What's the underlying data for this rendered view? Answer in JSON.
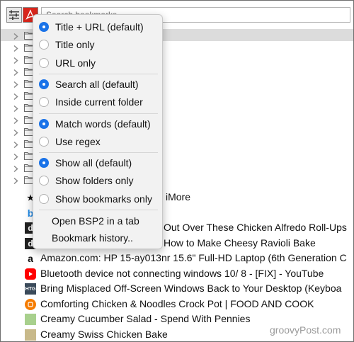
{
  "toolbar": {
    "options_icon": "sliders-icon",
    "pdf_icon": "acrobat-icon",
    "search_value": "",
    "search_placeholder": "Search bookmarks"
  },
  "tree": {
    "folder_rows": 13,
    "folder_icon": "folder-icon",
    "chevron_icon": "chevron-right-icon"
  },
  "bookmarks": [
    {
      "text": "iMore",
      "favicon": "imore-favicon",
      "color": "#111111"
    },
    {
      "text": "",
      "favicon": "bing-favicon",
      "color": "#1e88e5"
    },
    {
      "text": "Out Over These Chicken Alfredo Roll-Ups",
      "favicon": "dotdash-favicon",
      "color": "#222222"
    },
    {
      "text": "How to Make Cheesy Ravioli Bake",
      "favicon": "dotdash-favicon",
      "color": "#222222"
    },
    {
      "text": "Amazon.com: HP 15-ay013nr 15.6\" Full-HD Laptop (6th Generation C",
      "favicon": "amazon-favicon",
      "color": "#111111"
    },
    {
      "text": "Bluetooth device not connecting windows 10/ 8 - [FIX] - YouTube",
      "favicon": "youtube-favicon",
      "color": "#ff0000"
    },
    {
      "text": "Bring Misplaced Off-Screen Windows Back to Your Desktop (Keyboa",
      "favicon": "htg-favicon",
      "color": "#3a4a5a"
    },
    {
      "text": "Comforting Chicken & Noodles Crock Pot | FOOD AND COOK",
      "favicon": "blogger-favicon",
      "color": "#f57c00"
    },
    {
      "text": "Creamy Cucumber Salad - Spend With Pennies",
      "favicon": "pennies-favicon",
      "color": "#a8d08d"
    },
    {
      "text": "Creamy Swiss Chicken Bake",
      "favicon": "recipe-favicon",
      "color": "#c8b98a"
    }
  ],
  "menu": {
    "groups": [
      {
        "items": [
          {
            "label": "Title + URL (default)",
            "selected": true
          },
          {
            "label": "Title only",
            "selected": false
          },
          {
            "label": "URL only",
            "selected": false
          }
        ]
      },
      {
        "items": [
          {
            "label": "Search all (default)",
            "selected": true
          },
          {
            "label": "Inside current folder",
            "selected": false
          }
        ]
      },
      {
        "items": [
          {
            "label": "Match words (default)",
            "selected": true
          },
          {
            "label": "Use regex",
            "selected": false
          }
        ]
      },
      {
        "items": [
          {
            "label": "Show all (default)",
            "selected": true
          },
          {
            "label": "Show folders only",
            "selected": false
          },
          {
            "label": "Show bookmarks only",
            "selected": false
          }
        ]
      }
    ],
    "actions": [
      {
        "label": "Open BSP2 in a tab"
      },
      {
        "label": "Bookmark history.."
      }
    ],
    "accent_color": "#1a73e8"
  },
  "watermark": "groovyPost.com"
}
